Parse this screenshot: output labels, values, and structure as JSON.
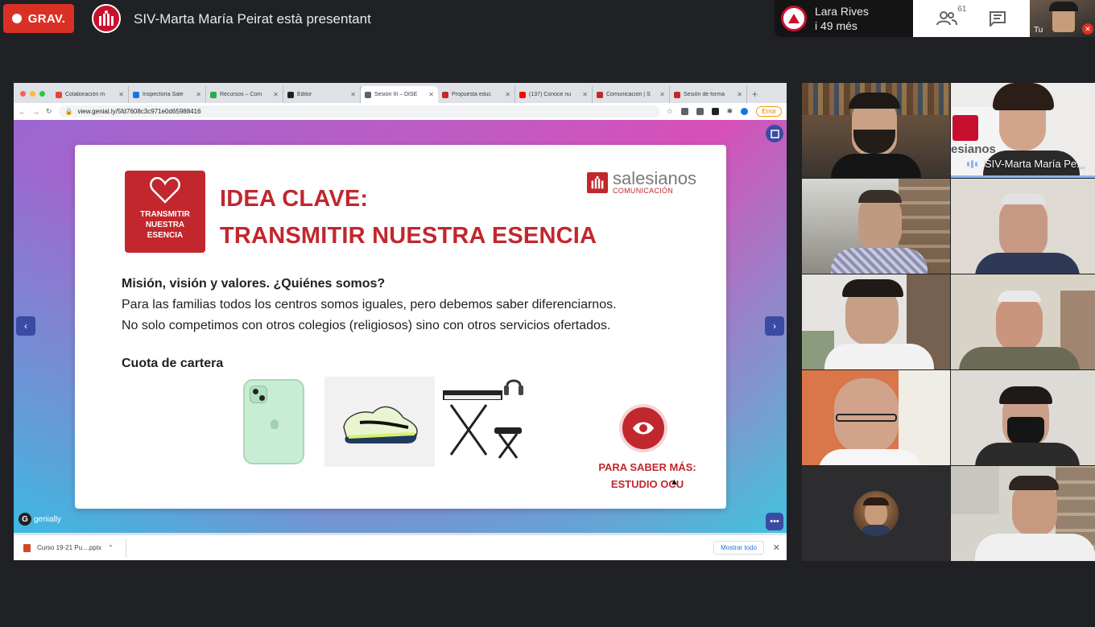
{
  "meet": {
    "record_label": "GRAV.",
    "presenting_text": "SIV-Marta María Peirat està presentant",
    "notification": {
      "name": "Lara Rives",
      "more": "i 49 més"
    },
    "participant_count": "61",
    "self_label": "Tu"
  },
  "browser": {
    "tabs": [
      {
        "title": "Colaboración m",
        "fav_color": "#ea4335"
      },
      {
        "title": "Inspectoría Sale",
        "fav_color": "#1a73e8"
      },
      {
        "title": "Recursos – Com",
        "fav_color": "#34a853"
      },
      {
        "title": "Editor",
        "fav_color": "#202124"
      },
      {
        "title": "Sesión III – DISE",
        "fav_color": "#5f6368"
      },
      {
        "title": "Propuesta educ",
        "fav_color": "#c1272d"
      },
      {
        "title": "(137) Conoce nu",
        "fav_color": "#ff0000"
      },
      {
        "title": "Comunicación | S",
        "fav_color": "#c1272d"
      },
      {
        "title": "Sesión de forma",
        "fav_color": "#c1272d"
      }
    ],
    "active_tab_index": 4,
    "url": "view.genial.ly/5fd7608c3c971e0d65988416",
    "error_label": "Error",
    "download_file": "Curso 19-21 Pu....pptx",
    "show_all": "Mostrar todo"
  },
  "slide": {
    "key_box_text": [
      "TRANSMITIR",
      "NUESTRA",
      "ESENCIA"
    ],
    "title_line1": "IDEA CLAVE:",
    "title_line2": "TRANSMITIR NUESTRA ESENCIA",
    "brand_name": "salesianos",
    "brand_sub": "COMUNICACIÓN",
    "heading": "Misión, visión y valores. ¿Quiénes somos?",
    "line1": "Para las familias todos los centros somos iguales, pero debemos saber diferenciarnos.",
    "line2": "No solo competimos con otros colegios (religiosos) sino con otros servicios ofertados.",
    "cuota": "Cuota de cartera",
    "cta_line1": "PARA SABER MÁS:",
    "cta_line2": "ESTUDIO OCU",
    "footer_brand": "genially"
  },
  "participants": {
    "presenter_label": "SIV-Marta María Pe...",
    "presenter_brand": "esianos"
  },
  "colors": {
    "record": "#d93025",
    "brand_red": "#c1272d",
    "nav_blue": "#3b4aa3",
    "meet_bg": "#202124"
  }
}
